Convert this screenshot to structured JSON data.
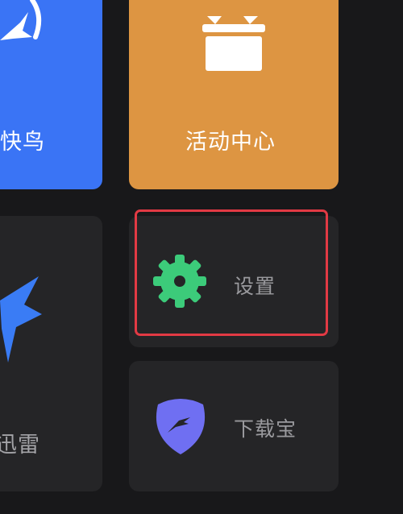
{
  "tiles": {
    "kuainiao": {
      "label": "快鸟",
      "icon": "kuainiao-bird-icon",
      "color": "#3a74f5"
    },
    "activity": {
      "label": "活动中心",
      "icon": "gift-icon",
      "color": "#dd9542"
    },
    "xunlei": {
      "label": "迅雷",
      "icon": "xunlei-bird-icon",
      "color": "#252527"
    },
    "settings": {
      "label": "设置",
      "icon": "gear-icon",
      "icon_color": "#3ccb7a",
      "highlight_color": "#e23a44"
    },
    "download": {
      "label": "下载宝",
      "icon": "download-shield-icon",
      "icon_color": "#6f6ff2"
    }
  }
}
